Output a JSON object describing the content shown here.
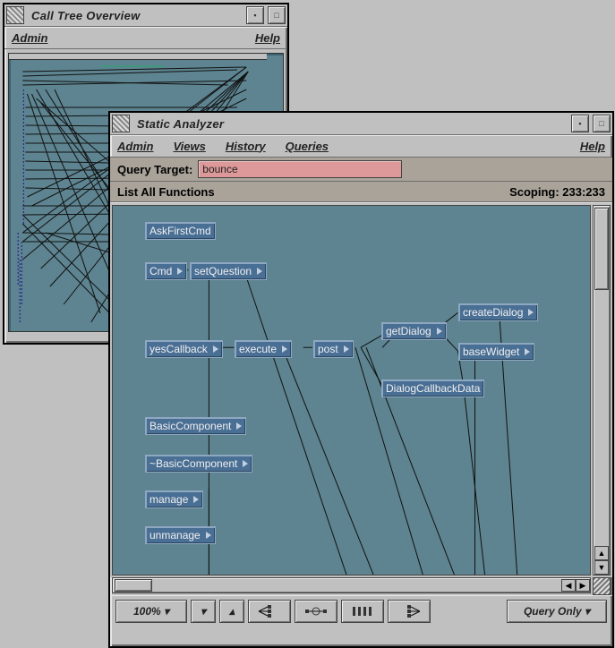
{
  "overview_window": {
    "title": "Call Tree Overview",
    "menus": {
      "admin": "Admin",
      "help": "Help"
    }
  },
  "analyzer_window": {
    "title": "Static Analyzer",
    "menus": {
      "admin": "Admin",
      "views": "Views",
      "history": "History",
      "queries": "Queries",
      "help": "Help"
    },
    "query_label": "Query Target:",
    "query_value": "bounce",
    "list_label": "List All Functions",
    "scoping_label": "Scoping: 233:233",
    "zoom_label": "100%",
    "query_only_label": "Query Only",
    "nodes": {
      "ask_first_cmd": "AskFirstCmd",
      "cmd": "Cmd",
      "set_question": "setQuestion",
      "yes_callback": "yesCallback",
      "execute": "execute",
      "post": "post",
      "get_dialog": "getDialog",
      "create_dialog": "createDialog",
      "base_widget": "baseWidget",
      "dialog_callback_data": "DialogCallbackData",
      "basic_component": "BasicComponent",
      "tilde_basic_component": "~BasicComponent",
      "manage": "manage",
      "unmanage": "unmanage"
    }
  }
}
